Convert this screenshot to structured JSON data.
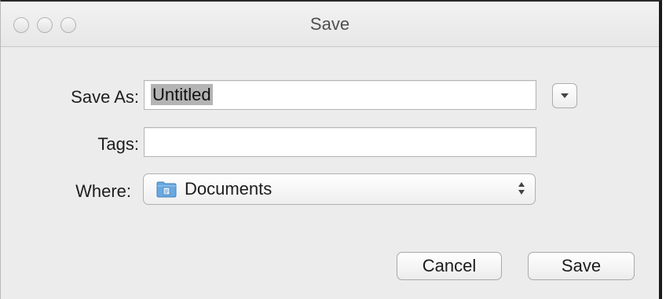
{
  "window": {
    "title": "Save"
  },
  "form": {
    "save_as_label": "Save As:",
    "save_as_value": "Untitled",
    "tags_label": "Tags:",
    "tags_value": "",
    "where_label": "Where:",
    "where_value": "Documents"
  },
  "icons": {
    "disclosure": "chevron-down-icon",
    "folder": "documents-folder-icon",
    "popup_arrows": "up-down-arrows-icon"
  },
  "buttons": {
    "cancel_label": "Cancel",
    "save_label": "Save"
  },
  "colors": {
    "folder_blue": "#6aa9e0",
    "selection": "#b4b4b4"
  }
}
